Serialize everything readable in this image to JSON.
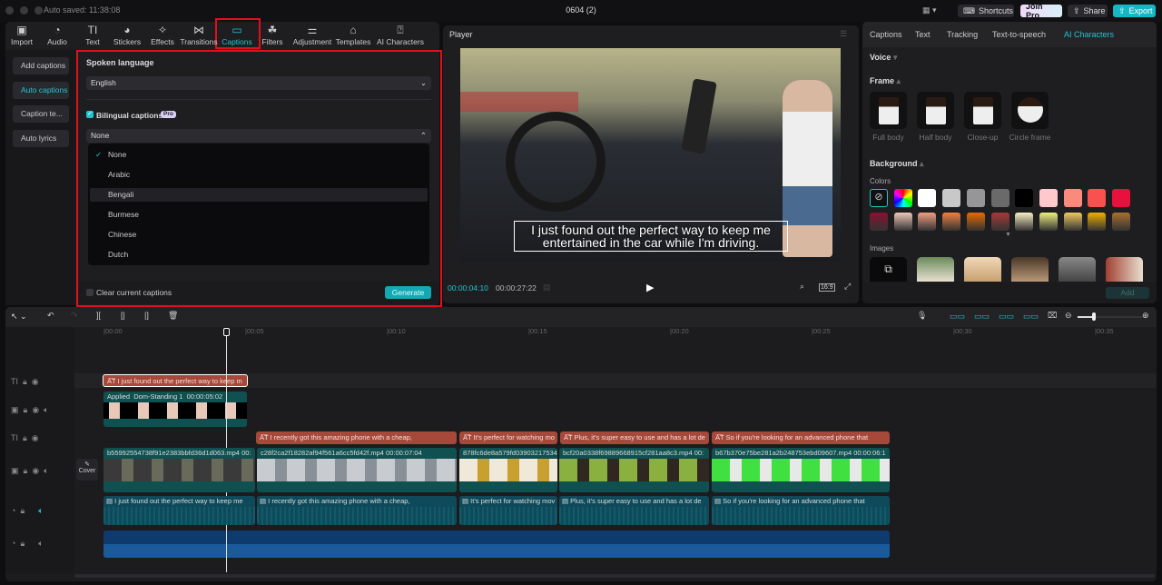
{
  "titlebar": {
    "autosave": "Auto saved: 11:38:08",
    "project_title": "0604 (2)",
    "shortcuts": "Shortcuts",
    "join_pro": "Join Pro",
    "share": "Share",
    "export": "Export"
  },
  "toolbar": [
    {
      "label": "Import",
      "icon": "import-icon"
    },
    {
      "label": "Audio",
      "icon": "audio-icon"
    },
    {
      "label": "Text",
      "icon": "text-icon"
    },
    {
      "label": "Stickers",
      "icon": "stickers-icon"
    },
    {
      "label": "Effects",
      "icon": "effects-icon"
    },
    {
      "label": "Transitions",
      "icon": "transitions-icon"
    },
    {
      "label": "Captions",
      "icon": "captions-icon",
      "active": true
    },
    {
      "label": "Filters",
      "icon": "filters-icon"
    },
    {
      "label": "Adjustment",
      "icon": "adjustment-icon"
    },
    {
      "label": "Templates",
      "icon": "templates-icon"
    },
    {
      "label": "AI Characters",
      "icon": "ai-characters-icon"
    }
  ],
  "captions_sidebar": [
    "Add captions",
    "Auto captions",
    "Caption te...",
    "Auto lyrics"
  ],
  "captions_panel": {
    "spoken_language_label": "Spoken language",
    "spoken_language": "English",
    "bilingual_label": "Bilingual captions",
    "bilingual_checked": true,
    "pro_badge": "Pro",
    "bilingual_value": "None",
    "options": [
      "None",
      "Arabic",
      "Bengali",
      "Burmese",
      "Chinese",
      "Dutch"
    ],
    "selected_option": "None",
    "hovered_option": "Bengali",
    "clear_label": "Clear current captions",
    "generate": "Generate"
  },
  "player": {
    "title": "Player",
    "subtitle_line1": "I just found out the perfect way to keep me",
    "subtitle_line2": "entertained in the car while I'm driving.",
    "current_time": "00:00:04:10",
    "total_time": "00:00:27:22",
    "ratio": "16:9"
  },
  "right_panel": {
    "tabs": [
      "Captions",
      "Text",
      "Tracking",
      "Text-to-speech",
      "AI Characters"
    ],
    "active_tab": "AI Characters",
    "voice": "Voice",
    "frame": "Frame",
    "frames": [
      "Full body",
      "Half body",
      "Close-up",
      "Circle frame"
    ],
    "background": "Background",
    "colors_label": "Colors",
    "colors": [
      "none",
      "rainbow",
      "#ffffff",
      "#c8c8c8",
      "#969696",
      "#6a6a6a",
      "#000000",
      "#ffc8cc",
      "#fa8a7c",
      "#fa5050",
      "#e8103c",
      "#8a1030",
      "#f0c8b8",
      "#f0a080",
      "#f08040",
      "#e86a00",
      "#a83838",
      "#f8f0c0",
      "#f0f080",
      "#f0c860",
      "#f0b000",
      "#a87030"
    ],
    "images_label": "Images",
    "add": "Add"
  },
  "timeline": {
    "ruler": [
      "00:00",
      "00:05",
      "00:10",
      "00:15",
      "00:20",
      "00:25",
      "00:30",
      "00:35"
    ],
    "cover": "Cover",
    "caption_track_1": [
      "I just found out the perfect way to keep m"
    ],
    "ai_clip": {
      "applied": "Applied",
      "name": "Dom-Standing 1",
      "duration": "00:00:05:02"
    },
    "caption_track_2": [
      "I recently got this amazing phone with a cheap,",
      "It's perfect for watching mo",
      "Plus, it's super easy to use and has a lot de",
      "So if you're looking for an advanced phone that"
    ],
    "video_clips": [
      {
        "name": "b55992554738f91e2383bbfd36d1d063.mp4",
        "duration": "00:"
      },
      {
        "name": "c28f2ca2f18282af94f561a6cc5fd42f.mp4",
        "duration": "00:00:07:04"
      },
      {
        "name": "878fc6de8a579fd03903217534",
        "duration": ""
      },
      {
        "name": "bcf20a0338f69889668915cf281aa8c3.mp4",
        "duration": "00:"
      },
      {
        "name": "b67b370e75be281a2b248753ebd09607.mp4",
        "duration": "00:00:06:1"
      }
    ],
    "audio_captions": [
      "I just found out the perfect way to keep me",
      "I recently got this amazing phone with a cheap,",
      "It's perfect for watching mov",
      "Plus, it's super easy to use and has a lot de",
      "So if you're looking for an advanced phone that"
    ]
  }
}
